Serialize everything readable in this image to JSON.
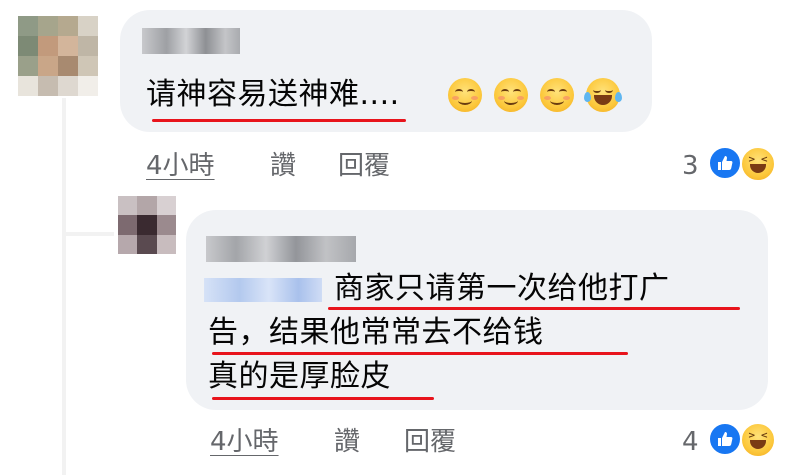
{
  "comments": [
    {
      "text": "请神容易送神难....",
      "emojis": [
        "smiling-face-icon",
        "smiling-face-icon",
        "smiling-face-icon",
        "laughing-tears-icon"
      ],
      "actions": {
        "time": "4小時",
        "like": "讚",
        "reply": "回覆"
      },
      "reaction_count": "3",
      "reaction_icons": [
        "like-reaction-icon",
        "haha-reaction-icon"
      ]
    },
    {
      "lines": [
        "商家只请第一次给他打广",
        "告，结果他常常去不给钱",
        "真的是厚脸皮"
      ],
      "actions": {
        "time": "4小時",
        "like": "讚",
        "reply": "回覆"
      },
      "reaction_count": "4",
      "reaction_icons": [
        "like-reaction-icon",
        "haha-reaction-icon"
      ]
    }
  ],
  "colors": {
    "bubble": "#f0f2f5",
    "underline": "#e8141c",
    "meta_text": "#65676b",
    "like_blue": "#1877f2"
  }
}
